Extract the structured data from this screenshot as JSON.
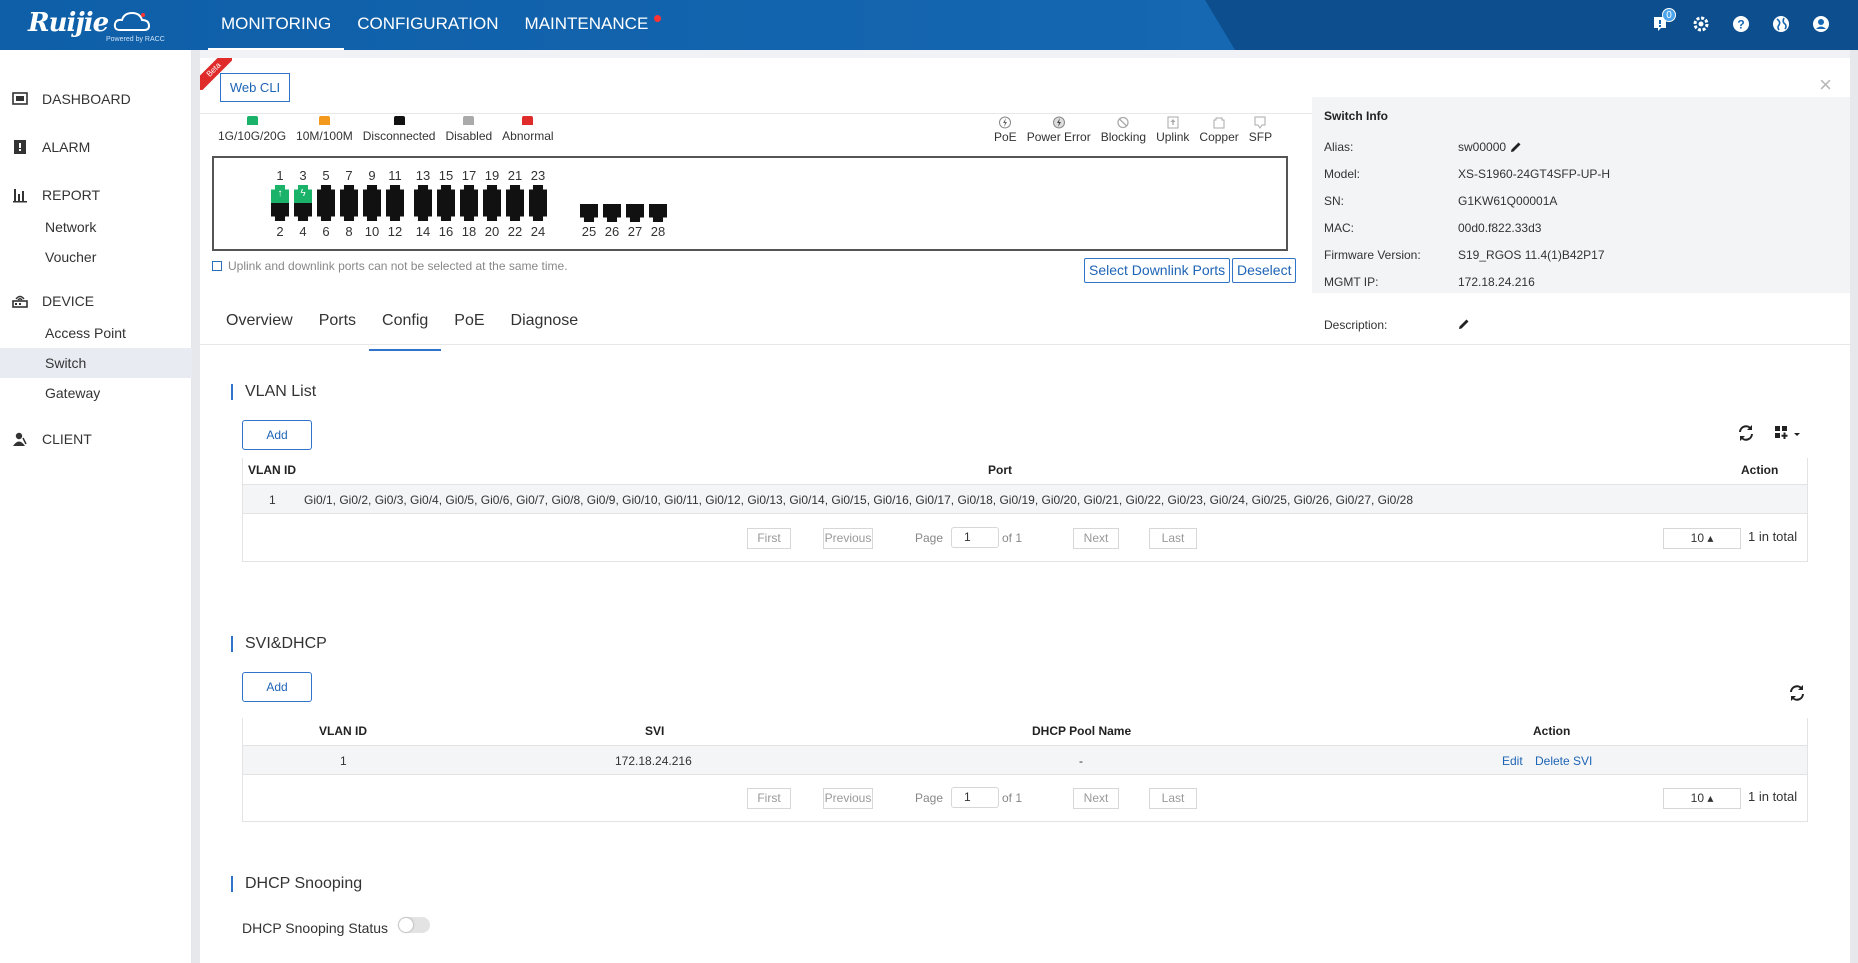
{
  "brand": {
    "logo_text": "Ruijie",
    "powered": "Powered by RACC"
  },
  "topnav": [
    {
      "label": "MONITORING"
    },
    {
      "label": "CONFIGURATION"
    },
    {
      "label": "MAINTENANCE"
    }
  ],
  "notification_count": "0",
  "sidebar": {
    "dashboard": "DASHBOARD",
    "alarm": "ALARM",
    "report": "REPORT",
    "report_items": [
      "Network",
      "Voucher"
    ],
    "device": "DEVICE",
    "device_items": [
      "Access Point",
      "Switch",
      "Gateway"
    ],
    "client": "CLIENT"
  },
  "panel": {
    "beta": "Beta",
    "web_cli": "Web CLI",
    "close": "×"
  },
  "legend_left": [
    {
      "label": "1G/10G/20G",
      "color": "#1bb36a"
    },
    {
      "label": "10M/100M",
      "color": "#f39a1e"
    },
    {
      "label": "Disconnected",
      "color": "#111111"
    },
    {
      "label": "Disabled",
      "color": "#aaaaaa"
    },
    {
      "label": "Abnormal",
      "color": "#e02b2b"
    }
  ],
  "legend_right": [
    {
      "label": "PoE",
      "icon": "poe-icon"
    },
    {
      "label": "Power Error",
      "icon": "power-error-icon"
    },
    {
      "label": "Blocking",
      "icon": "blocking-icon"
    },
    {
      "label": "Uplink",
      "icon": "uplink-icon"
    },
    {
      "label": "Copper",
      "icon": "copper-icon"
    },
    {
      "label": "SFP",
      "icon": "sfp-icon"
    }
  ],
  "ports": {
    "top_row": [
      "1",
      "3",
      "5",
      "7",
      "9",
      "11",
      "13",
      "15",
      "17",
      "19",
      "21",
      "23"
    ],
    "bottom_row": [
      "2",
      "4",
      "6",
      "8",
      "10",
      "12",
      "14",
      "16",
      "18",
      "20",
      "22",
      "24"
    ],
    "sfp": [
      "25",
      "26",
      "27",
      "28"
    ],
    "active_ports": [
      "1",
      "3"
    ]
  },
  "hint": "Uplink and downlink ports can not be selected at the same time.",
  "buttons": {
    "select_downlink": "Select Downlink Ports",
    "deselect": "Deselect"
  },
  "tabs": [
    {
      "label": "Overview"
    },
    {
      "label": "Ports"
    },
    {
      "label": "Config"
    },
    {
      "label": "PoE"
    },
    {
      "label": "Diagnose"
    }
  ],
  "switch_info": {
    "title": "Switch Info",
    "rows": [
      {
        "label": "Alias:",
        "value": "sw00000"
      },
      {
        "label": "Model:",
        "value": "XS-S1960-24GT4SFP-UP-H"
      },
      {
        "label": "SN:",
        "value": "G1KW61Q00001A"
      },
      {
        "label": "MAC:",
        "value": "00d0.f822.33d3"
      },
      {
        "label": "Firmware Version:",
        "value": "S19_RGOS 11.4(1)B42P17"
      },
      {
        "label": "MGMT IP:",
        "value": "172.18.24.216"
      },
      {
        "label": "Description:",
        "value": ""
      }
    ]
  },
  "vlan": {
    "title": "VLAN List",
    "add": "Add",
    "headers": {
      "id": "VLAN ID",
      "port": "Port",
      "action": "Action"
    },
    "rows": [
      {
        "id": "1",
        "port": "Gi0/1, Gi0/2, Gi0/3, Gi0/4, Gi0/5, Gi0/6, Gi0/7, Gi0/8, Gi0/9, Gi0/10, Gi0/11, Gi0/12, Gi0/13, Gi0/14, Gi0/15, Gi0/16, Gi0/17, Gi0/18, Gi0/19, Gi0/20, Gi0/21, Gi0/22, Gi0/23, Gi0/24, Gi0/25, Gi0/26, Gi0/27, Gi0/28"
      }
    ]
  },
  "svi": {
    "title": "SVI&DHCP",
    "add": "Add",
    "headers": {
      "id": "VLAN ID",
      "svi": "SVI",
      "pool": "DHCP Pool Name",
      "action": "Action"
    },
    "rows": [
      {
        "id": "1",
        "svi": "172.18.24.216",
        "pool": "-",
        "edit": "Edit",
        "delete": "Delete SVI"
      }
    ]
  },
  "pager": {
    "first": "First",
    "previous": "Previous",
    "page": "Page",
    "page_value": "1",
    "of": "of 1",
    "next": "Next",
    "last": "Last",
    "page_size": "10 ▴",
    "total": "1 in total"
  },
  "dhcp_snooping": {
    "title": "DHCP Snooping",
    "status_label": "DHCP Snooping Status",
    "enabled": false
  }
}
